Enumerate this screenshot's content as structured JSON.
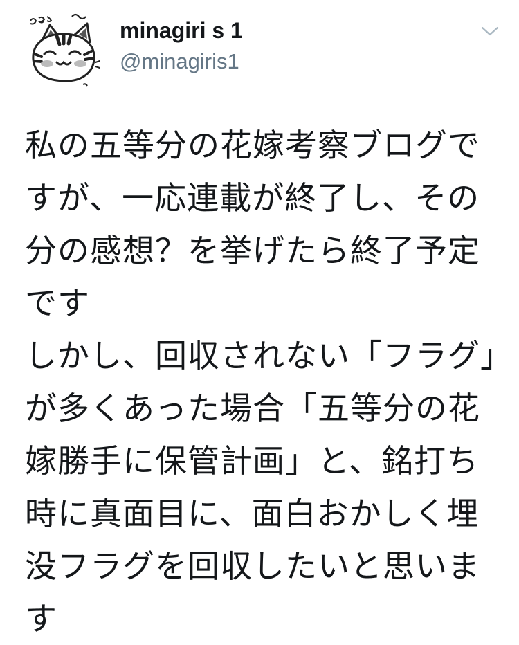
{
  "tweet": {
    "author": {
      "display_name": "minagiri s 1",
      "handle": "@minagiris1",
      "avatar_icon": "cat-avatar-icon",
      "avatar_doodle_text": "ふるえ〜"
    },
    "menu_icon": "chevron-down-icon",
    "text": "私の五等分の花嫁考察ブログですが、一応連載が終了し、その分の感想？を挙げたら終了予定です\nしかし、回収されない「フラグ」が多くあった場合「五等分の花嫁勝手に保管計画」と、銘打ち　時に真面目に、面白おかしく埋没フラグを回収したいと思います"
  },
  "colors": {
    "text_primary": "#14171a",
    "text_secondary": "#657786",
    "chevron": "#aab8c2",
    "background": "#ffffff"
  }
}
